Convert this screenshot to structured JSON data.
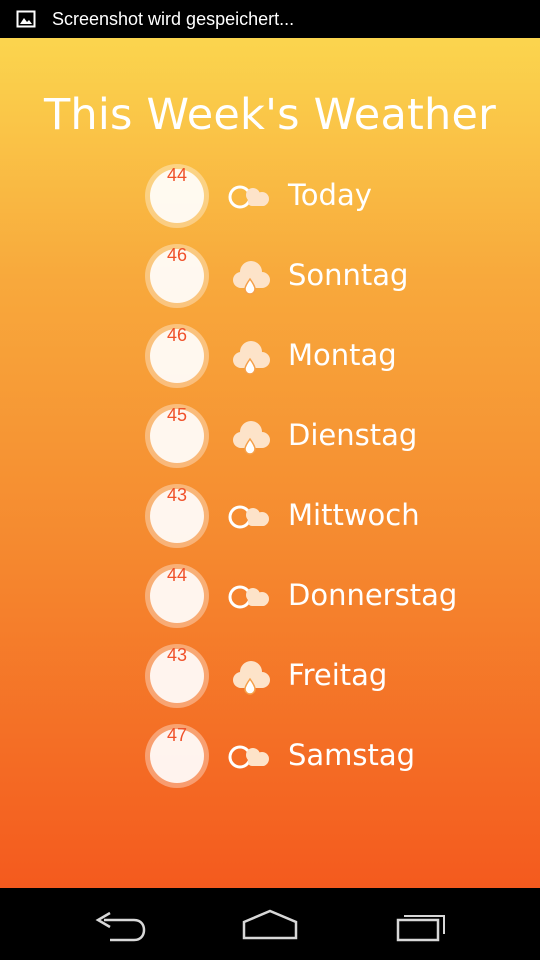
{
  "status_bar": {
    "notification_icon": "image-icon",
    "text": "Screenshot wird gespeichert..."
  },
  "header": {
    "title": "This Week's Weather"
  },
  "weather": {
    "days": [
      {
        "temp": "44",
        "icon": "partly-cloudy-icon",
        "day": "Today"
      },
      {
        "temp": "46",
        "icon": "rain-cloud-icon",
        "day": "Sonntag"
      },
      {
        "temp": "46",
        "icon": "rain-cloud-icon",
        "day": "Montag"
      },
      {
        "temp": "45",
        "icon": "rain-cloud-icon",
        "day": "Dienstag"
      },
      {
        "temp": "43",
        "icon": "partly-cloudy-icon",
        "day": "Mittwoch"
      },
      {
        "temp": "44",
        "icon": "partly-cloudy-icon",
        "day": "Donnerstag"
      },
      {
        "temp": "43",
        "icon": "rain-cloud-icon",
        "day": "Freitag"
      },
      {
        "temp": "47",
        "icon": "partly-cloudy-icon",
        "day": "Samstag"
      }
    ]
  },
  "nav_bar": {
    "back_icon": "back-icon",
    "home_icon": "home-icon",
    "recents_icon": "recent-apps-icon"
  },
  "colors": {
    "gradient_top": "#fbd54e",
    "gradient_bottom": "#f45a1e",
    "temperature_text": "#f0512a"
  }
}
